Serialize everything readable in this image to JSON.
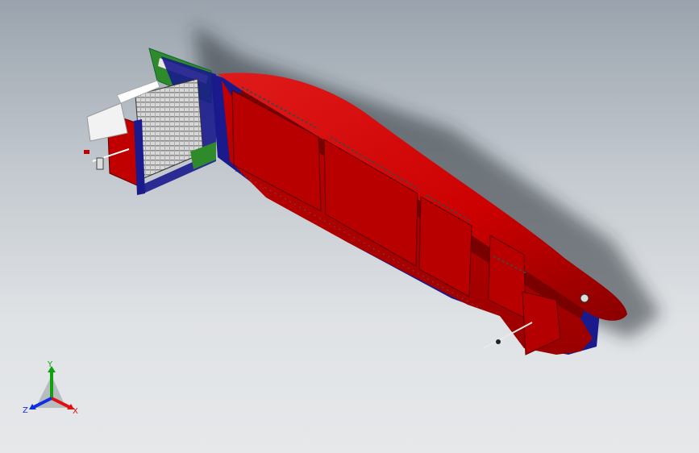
{
  "viewport": {
    "background_top": "#9aa3ad",
    "background_bottom": "#e6e8ea"
  },
  "model": {
    "hull_color": "#cc0000",
    "side_color": "#b30000",
    "boot_top_color": "#1a1a8c",
    "deck_house_color": "#3a8a2a",
    "rail_color": "#e8e8e8"
  },
  "triad": {
    "x_label": "X",
    "y_label": "Y",
    "z_label": "Z",
    "x_color": "#e01010",
    "y_color": "#10a010",
    "z_color": "#1030e0"
  }
}
